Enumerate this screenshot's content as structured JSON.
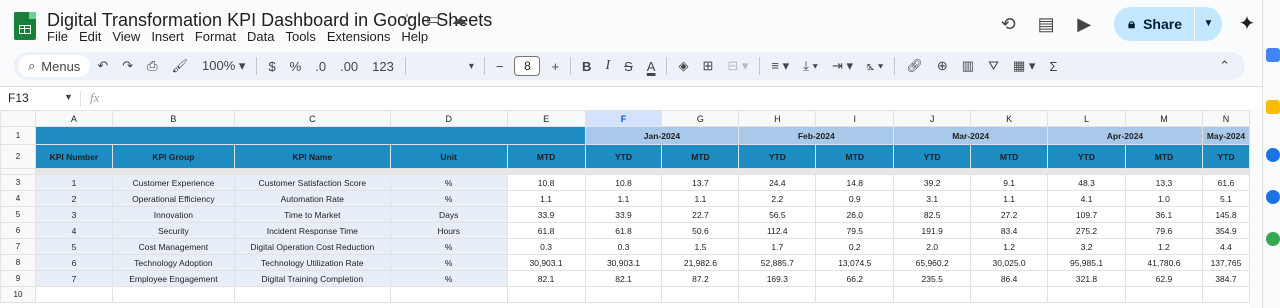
{
  "app": {
    "doc_title": "Digital Transformation KPI Dashboard in Google Sheets",
    "menu": [
      "File",
      "Edit",
      "View",
      "Insert",
      "Format",
      "Data",
      "Tools",
      "Extensions",
      "Help"
    ],
    "share_label": "Share"
  },
  "toolbar": {
    "menus_label": "Menus",
    "zoom": "100%",
    "currency": "$",
    "percent": "%",
    "dec_decrease": ".0",
    "dec_increase": ".00",
    "number_format": "123",
    "font_size": "8",
    "bold": "B",
    "italic": "I",
    "strike": "S",
    "text_color": "A",
    "functions": "Σ"
  },
  "formula_bar": {
    "cell_ref": "F13",
    "fx": "fx"
  },
  "sheet": {
    "columns": [
      "A",
      "B",
      "C",
      "D",
      "E",
      "F",
      "G",
      "H",
      "I",
      "J",
      "K",
      "L",
      "M",
      "N"
    ],
    "selected_column": "F",
    "row_numbers": [
      "1",
      "2",
      "3",
      "4",
      "5",
      "6",
      "7",
      "8",
      "9",
      "10"
    ],
    "headers": [
      "KPI Number",
      "KPI Group",
      "KPI Name",
      "Unit"
    ],
    "months": [
      "Jan-2024",
      "Feb-2024",
      "Mar-2024",
      "Apr-2024",
      "May-2024"
    ],
    "mtd": "MTD",
    "ytd": "YTD",
    "rows": [
      {
        "num": "1",
        "group": "Customer Experience",
        "name": "Customer Satisfaction Score",
        "unit": "%",
        "vals": [
          "10.8",
          "10.8",
          "13.7",
          "24.4",
          "14.8",
          "39.2",
          "9.1",
          "48.3",
          "13.3",
          "61.6"
        ]
      },
      {
        "num": "2",
        "group": "Operational Efficiency",
        "name": "Automation Rate",
        "unit": "%",
        "vals": [
          "1.1",
          "1.1",
          "1.1",
          "2.2",
          "0.9",
          "3.1",
          "1.1",
          "4.1",
          "1.0",
          "5.1"
        ]
      },
      {
        "num": "3",
        "group": "Innovation",
        "name": "Time to Market",
        "unit": "Days",
        "vals": [
          "33.9",
          "33.9",
          "22.7",
          "56.5",
          "26.0",
          "82.5",
          "27.2",
          "109.7",
          "36.1",
          "145.8"
        ]
      },
      {
        "num": "4",
        "group": "Security",
        "name": "Incident Response Time",
        "unit": "Hours",
        "vals": [
          "61.8",
          "61.8",
          "50.6",
          "112.4",
          "79.5",
          "191.9",
          "83.4",
          "275.2",
          "79.6",
          "354.9"
        ]
      },
      {
        "num": "5",
        "group": "Cost Management",
        "name": "Digital Operation Cost Reduction",
        "unit": "%",
        "vals": [
          "0.3",
          "0.3",
          "1.5",
          "1.7",
          "0.2",
          "2.0",
          "1.2",
          "3.2",
          "1.2",
          "4.4"
        ]
      },
      {
        "num": "6",
        "group": "Technology Adoption",
        "name": "Technology Utilization Rate",
        "unit": "%",
        "vals": [
          "30,903.1",
          "30,903.1",
          "21,982.6",
          "52,885.7",
          "13,074.5",
          "65,960.2",
          "30,025.0",
          "95,985.1",
          "41,780.6",
          "137,765"
        ]
      },
      {
        "num": "7",
        "group": "Employee Engagement",
        "name": "Digital Training Completion",
        "unit": "%",
        "vals": [
          "82.1",
          "82.1",
          "87.2",
          "169.3",
          "66.2",
          "235.5",
          "86.4",
          "321.8",
          "62.9",
          "384.7"
        ]
      }
    ]
  }
}
